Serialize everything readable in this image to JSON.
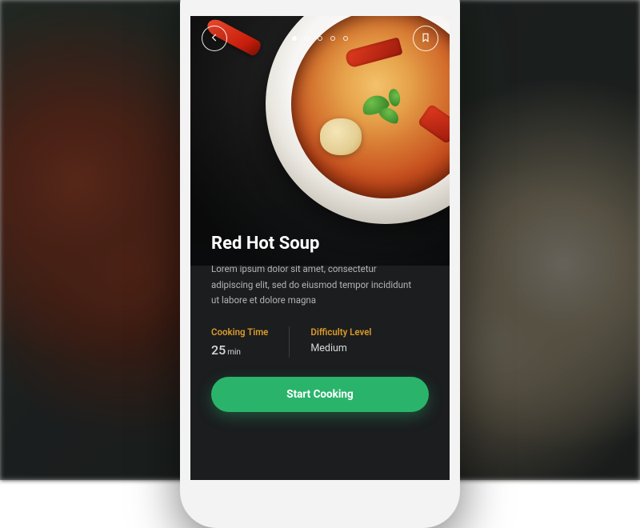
{
  "pagination": {
    "count": 5,
    "active_index": 0
  },
  "recipe": {
    "title": "Red Hot Soup",
    "description": "Lorem ipsum dolor sit amet, consectetur adipiscing elit, sed do eiusmod tempor incididunt ut labore et dolore magna",
    "cooking_time_label": "Cooking Time",
    "cooking_time_value": "25",
    "cooking_time_unit": "min",
    "difficulty_label": "Difficulty Level",
    "difficulty_value": "Medium"
  },
  "actions": {
    "start_cooking": "Start Cooking"
  },
  "colors": {
    "accent_orange": "#d99a2b",
    "cta_green": "#2ab46b"
  }
}
